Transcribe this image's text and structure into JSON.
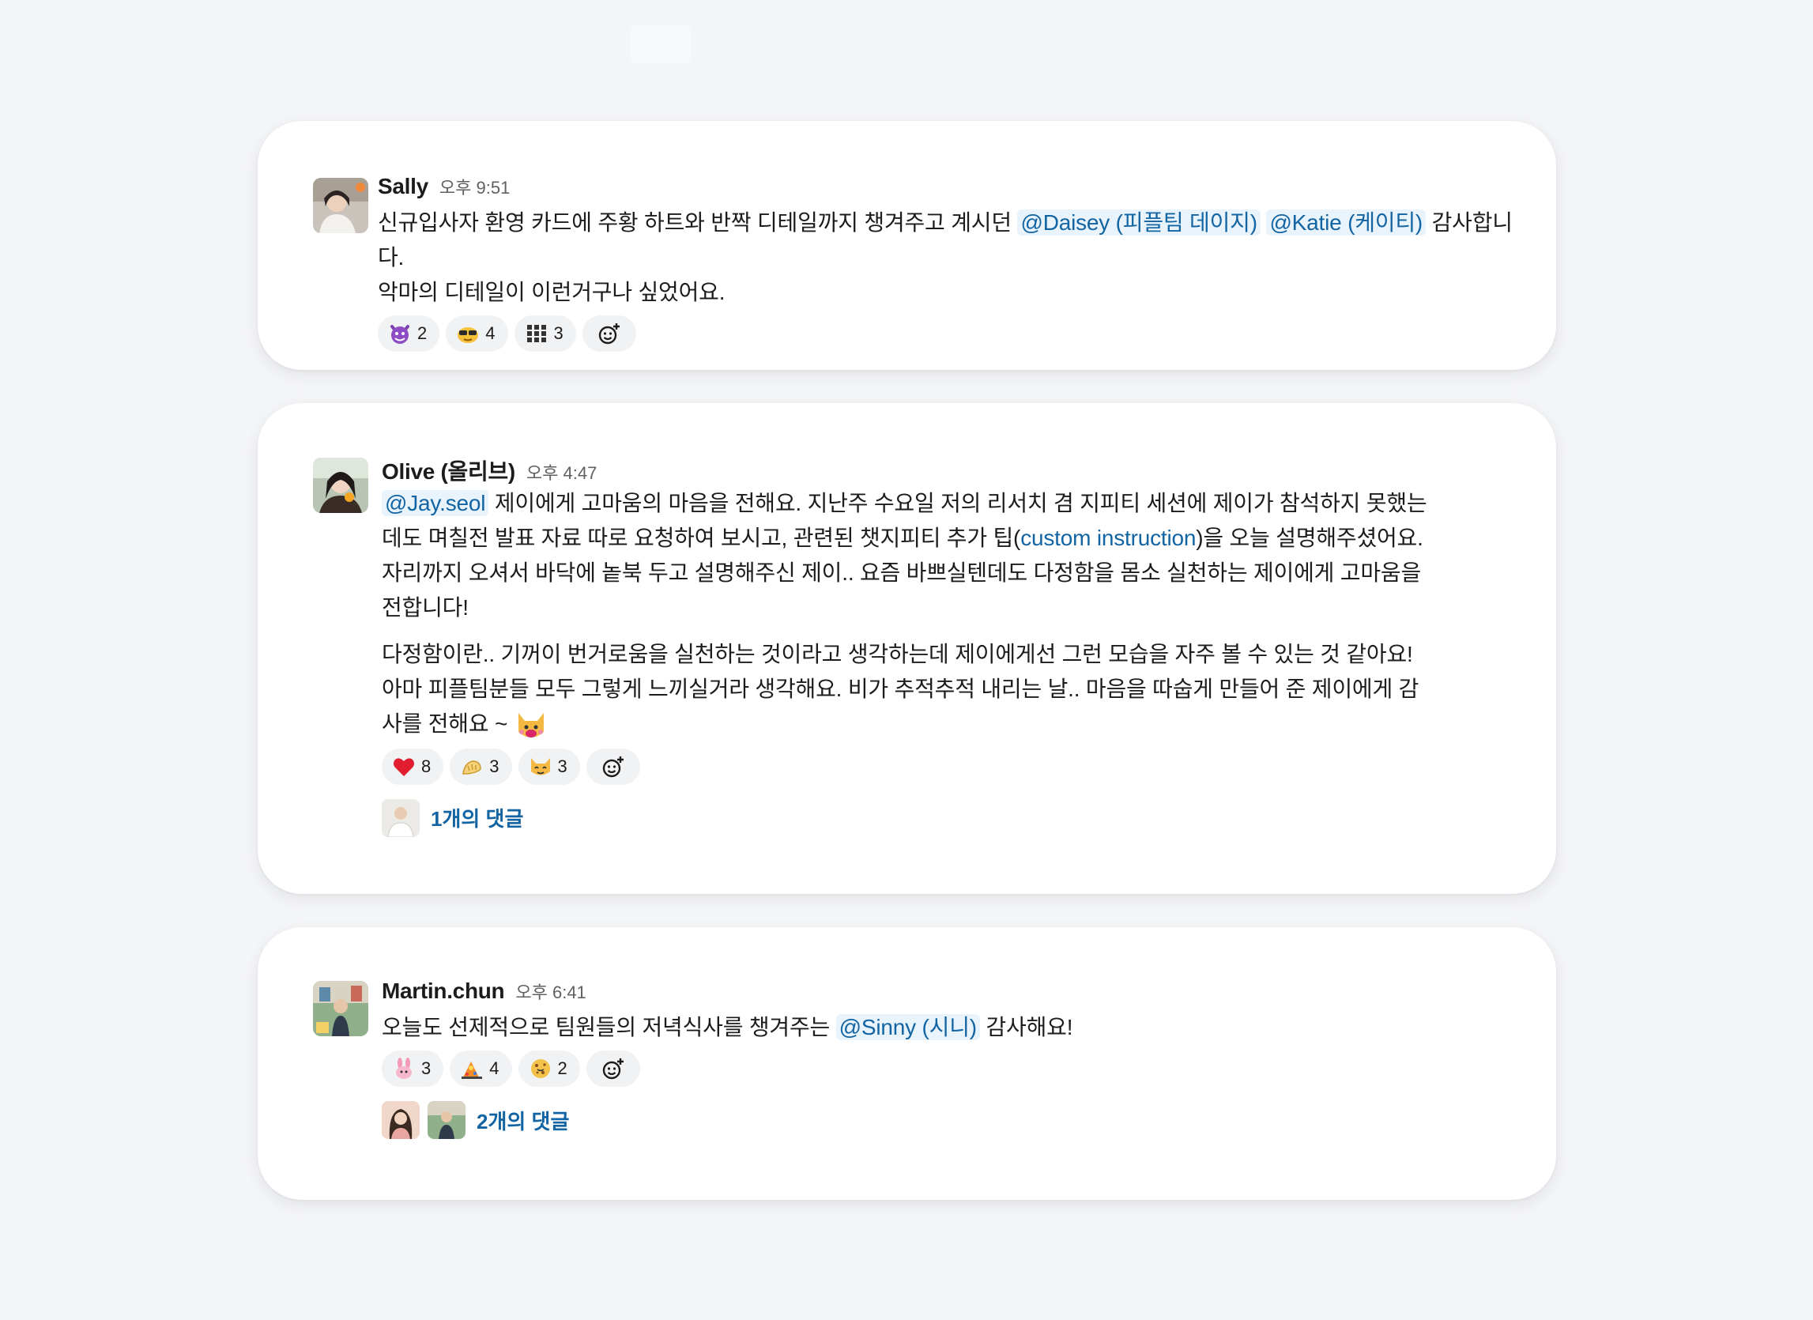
{
  "messages": [
    {
      "author": "Sally",
      "time": "오후 9:51",
      "text_1": "신규입사자 환영 카드에 주황 하트와 반짝 디테일까지 챙겨주고 계시던 ",
      "mention_1": "@Daisey (피플팀 데이지)",
      "mention_2": "@Katie (케이티)",
      "text_2": " 감사합니다.",
      "text_3": "악마의 디테일이 이런거구나 싶었어요.",
      "reactions": [
        {
          "icon": "smiling-devil-icon",
          "count": "2"
        },
        {
          "icon": "cool-sunglasses-icon",
          "count": "4"
        },
        {
          "icon": "clapping-grid-icon",
          "count": "3"
        }
      ]
    },
    {
      "author": "Olive (올리브)",
      "time": "오후 4:47",
      "mention_1": "@Jay.seol",
      "text_1": " 제이에게 고마움의 마음을 전해요. 지난주 수요일 저의 리서치 겸 지피티 세션에 제이가 참석하지 못했는데도 며칠전 발표 자료 따로 요청하여 보시고, 관련된 챗지피티 추가 팁(",
      "link_1": "custom instruction",
      "text_2": ")을 오늘 설명해주셨어요. 자리까지 오셔서 바닥에 놑북 두고 설명해주신 제이.. 요즘 바쁘실텐데도 다정함을 몸소 실천하는 제이에게 고마움을 전합니다!",
      "text_3": "다정함이란.. 기꺼이 번거로움을 실천하는 것이라고 생각하는데 제이에게선 그런 모습을 자주 볼 수 있는 것 같아요! 아마 피플팀분들 모두 그렇게 느끼실거라 생각해요. 비가 추적추적 내리는 날.. 마음을 따숩게 만들어 준 제이에게 감사를 전해요 ~",
      "inline_emoji": "blushing-cat-icon",
      "reactions": [
        {
          "icon": "red-heart-icon",
          "count": "8"
        },
        {
          "icon": "bowing-hands-icon",
          "count": "3"
        },
        {
          "icon": "happy-cat-icon",
          "count": "3"
        }
      ],
      "thread_label": "1개의 댓글"
    },
    {
      "author": "Martin.chun",
      "time": "오후 6:41",
      "text_1": "오늘도 선제적으로 팀원들의 저녁식사를 챙겨주는 ",
      "mention_1": "@Sinny (시니)",
      "text_2": " 감사해요!",
      "reactions": [
        {
          "icon": "pink-bunny-icon",
          "count": "3"
        },
        {
          "icon": "party-cooking-icon",
          "count": "4"
        },
        {
          "icon": "cookie-face-icon",
          "count": "2"
        }
      ],
      "thread_label": "2개의 댓글"
    }
  ],
  "colors": {
    "background": "#f4f5f7",
    "card": "#ffffff",
    "mention_bg": "#e8f3fb",
    "link": "#1264a3"
  }
}
